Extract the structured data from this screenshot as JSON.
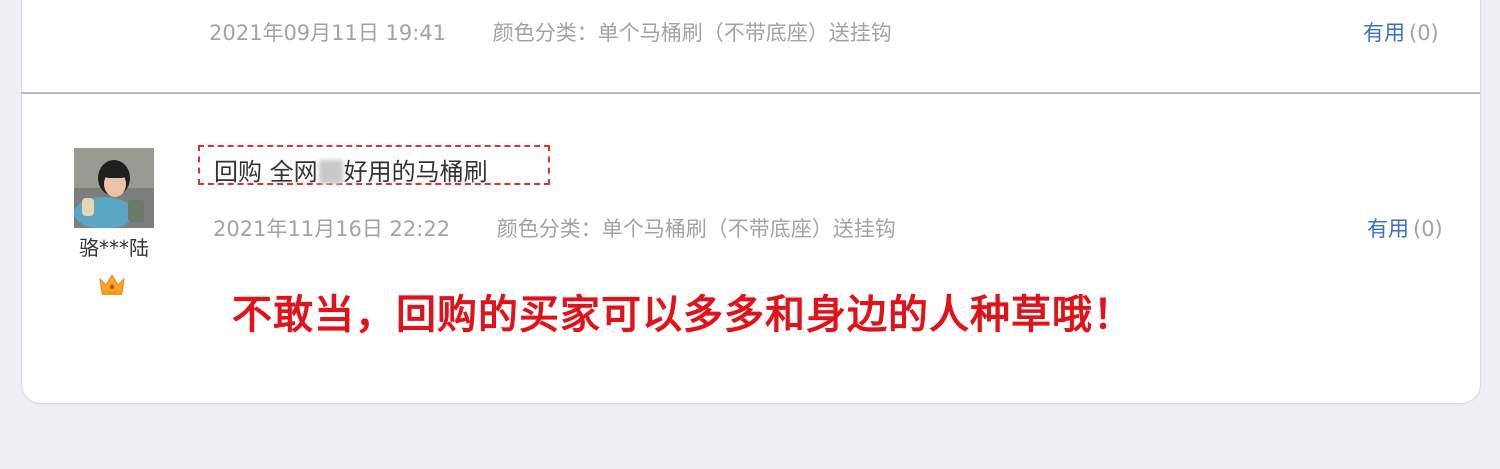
{
  "review_prev": {
    "date": "2021年09月11日 19:41",
    "sku": "颜色分类：单个马桶刷（不带底座）送挂钩",
    "useful_label": "有用",
    "useful_count": "(0)"
  },
  "review": {
    "username": "骆***陆",
    "title_part1": "回购 全网",
    "title_part2": "好用的马桶刷",
    "date": "2021年11月16日 22:22",
    "sku": "颜色分类：单个马桶刷（不带底座）送挂钩",
    "useful_label": "有用",
    "useful_count": "(0)"
  },
  "annotation": "不敢当，回购的买家可以多多和身边的人种草哦！",
  "colors": {
    "background": "#eef0f5",
    "link": "#3a6fc7",
    "meta": "#a3a3a3",
    "annotation": "#e0121a",
    "dashed_border": "#e0302f"
  },
  "icons": {
    "avatar": "user-photo",
    "badge": "crown-icon"
  }
}
